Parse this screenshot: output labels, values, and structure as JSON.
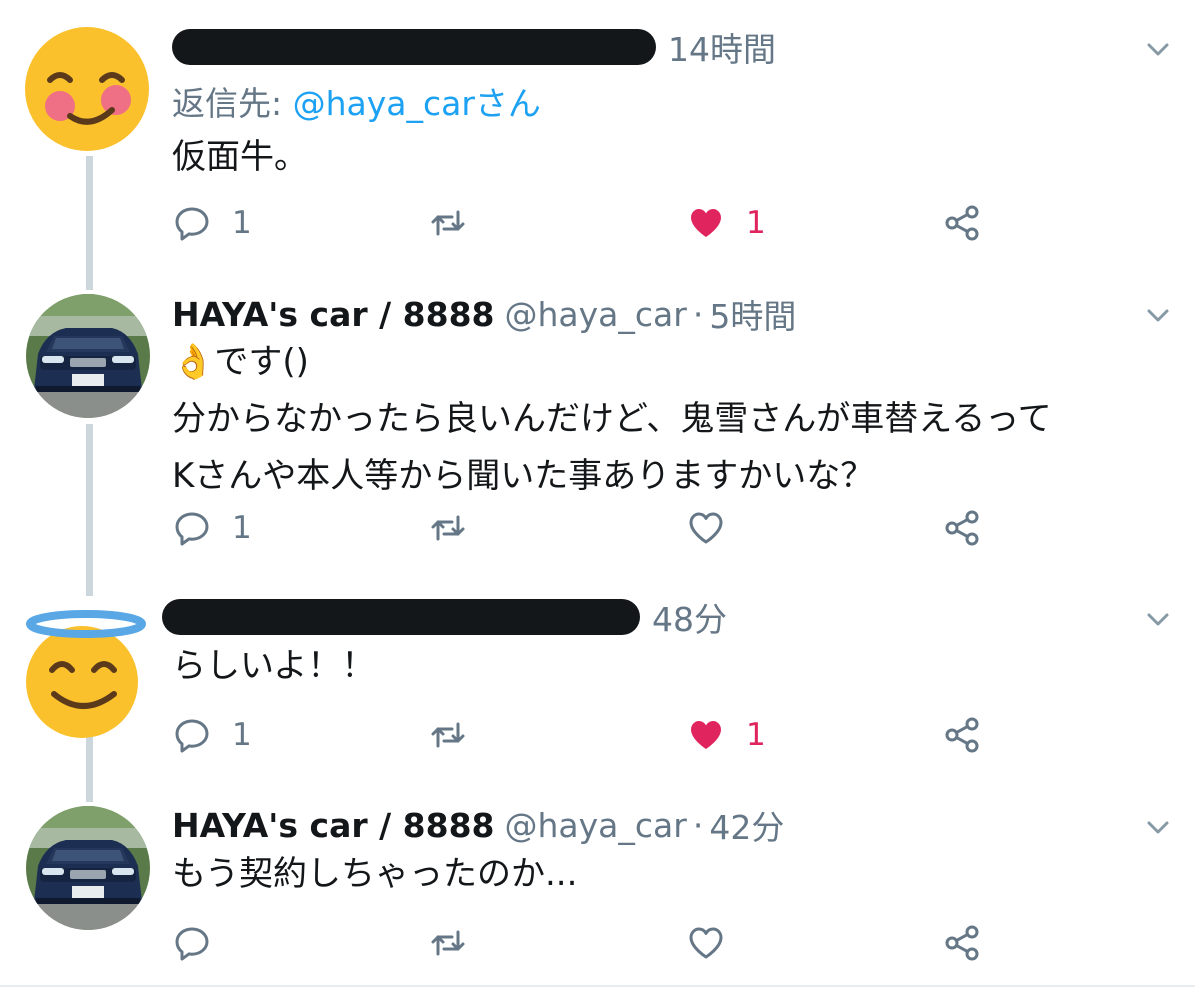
{
  "tweets": [
    {
      "author_redacted": true,
      "time": "14時間",
      "reply_prefix": "返信先: ",
      "reply_mention": "@haya_carさん",
      "text_lines": [
        "仮面牛。"
      ],
      "reply_count": "1",
      "retweet_count": "",
      "like_count": "1",
      "liked": true,
      "avatar_icon": "smiling-face-icon"
    },
    {
      "display_name": "HAYA's car / 8888",
      "handle": "@haya_car",
      "time": "5時間",
      "text_lines": [
        "👌です()",
        "分からなかったら良いんだけど、鬼雪さんが車替えるって",
        "Kさんや本人等から聞いた事ありますかいな？"
      ],
      "reply_count": "1",
      "retweet_count": "",
      "like_count": "",
      "liked": false,
      "avatar_icon": "car-photo-avatar"
    },
    {
      "author_redacted": true,
      "time": "48分",
      "text_lines": [
        "らしいよ！！"
      ],
      "reply_count": "1",
      "retweet_count": "",
      "like_count": "1",
      "liked": true,
      "avatar_icon": "halo-face-icon"
    },
    {
      "display_name": "HAYA's car / 8888",
      "handle": "@haya_car",
      "time": "42分",
      "text_lines": [
        "もう契約しちゃったのか..."
      ],
      "reply_count": "",
      "retweet_count": "",
      "like_count": "",
      "liked": false,
      "avatar_icon": "car-photo-avatar"
    }
  ],
  "separator": "·",
  "colors": {
    "text": "#14171a",
    "secondary": "#657786",
    "link": "#1da1f2",
    "like": "#e0245e",
    "thread_line": "#ccd6dd"
  }
}
